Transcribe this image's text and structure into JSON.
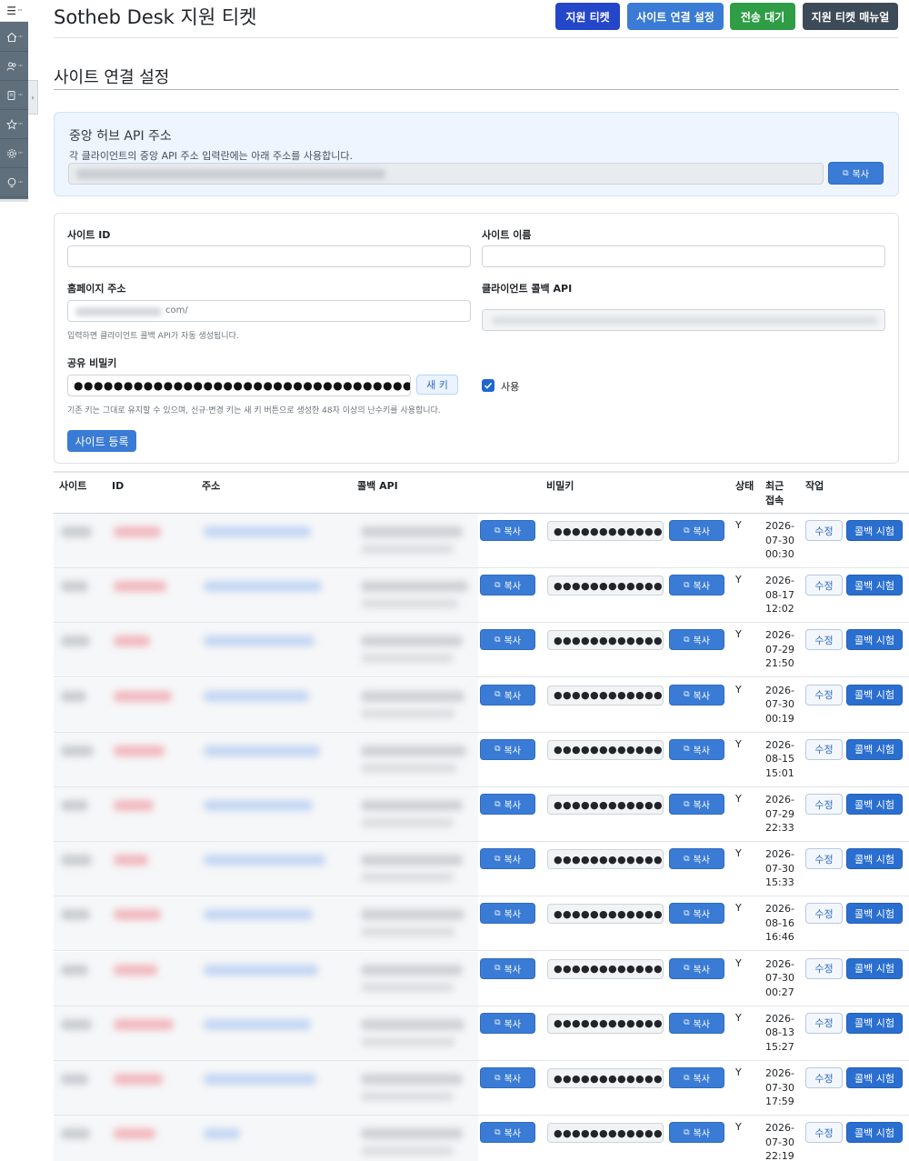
{
  "sidebar": {
    "menu_glyph": "☰",
    "items": [
      {
        "icon": "home-icon"
      },
      {
        "icon": "users-icon"
      },
      {
        "icon": "document-icon"
      },
      {
        "icon": "star-icon"
      },
      {
        "icon": "gear-icon"
      },
      {
        "icon": "help-icon"
      }
    ],
    "toggle_glyph": "›"
  },
  "header": {
    "title": "Sotheb Desk 지원 티켓",
    "buttons": [
      {
        "label": "지원 티켓",
        "color": "#2446c8"
      },
      {
        "label": "사이트 연결 설정",
        "color": "#3a7bd5"
      },
      {
        "label": "전송 대기",
        "color": "#2e9d46"
      },
      {
        "label": "지원 티켓 매뉴얼",
        "color": "#3d4a58"
      }
    ]
  },
  "section": {
    "title": "사이트 연결 설정"
  },
  "hub": {
    "title": "중앙 허브 API 주소",
    "description": "각 클라이언트의 중앙 API 주소 입력란에는 아래 주소를 사용합니다.",
    "copy_label": "복사"
  },
  "form": {
    "site_id_label": "사이트 ID",
    "site_name_label": "사이트 이름",
    "homepage_label": "홈페이지 주소",
    "homepage_value": "com/",
    "homepage_hint": "입력하면 클라이언트 콜백 API가 자동 생성됩니다.",
    "callback_label": "클라이언트 콜백 API",
    "secret_label": "공유 비밀키",
    "secret_value": "●●●●●●●●●●●●●●●●●●●●●●●●●●●●●●●●●●●●●●●●●●●●●●●●",
    "new_key_label": "새 키",
    "enabled_label": "사용",
    "secret_hint": "기존 키는 그대로 유지할 수 있으며, 신규·변경 키는 새 키 버튼으로 생성한 48자 이상의 난수키를 사용합니다.",
    "submit_label": "사이트 등록"
  },
  "table": {
    "columns": {
      "site": "사이트",
      "id": "ID",
      "address": "주소",
      "callback": "콜백 API",
      "secret": "비밀키",
      "status": "상태",
      "last_line1": "최근",
      "last_line2": "접속",
      "action": "작업"
    },
    "copy_label": "복사",
    "edit_label": "수정",
    "test_label": "콜백 시험",
    "masked_secret": "●●●●●●●●●●●●",
    "rows": [
      {
        "status": "Y",
        "date": "2026-",
        "date2": "07-30",
        "time": "00:30"
      },
      {
        "status": "Y",
        "date": "2026-",
        "date2": "08-17",
        "time": "12:02"
      },
      {
        "status": "Y",
        "date": "2026-",
        "date2": "07-29",
        "time": "21:50"
      },
      {
        "status": "Y",
        "date": "2026-",
        "date2": "07-30",
        "time": "00:19"
      },
      {
        "status": "Y",
        "date": "2026-",
        "date2": "08-15",
        "time": "15:01"
      },
      {
        "status": "Y",
        "date": "2026-",
        "date2": "07-29",
        "time": "22:33"
      },
      {
        "status": "Y",
        "date": "2026-",
        "date2": "07-30",
        "time": "15:33"
      },
      {
        "status": "Y",
        "date": "2026-",
        "date2": "08-16",
        "time": "16:46"
      },
      {
        "status": "Y",
        "date": "2026-",
        "date2": "07-30",
        "time": "00:27"
      },
      {
        "status": "Y",
        "date": "2026-",
        "date2": "08-13",
        "time": "15:27"
      },
      {
        "status": "Y",
        "date": "2026-",
        "date2": "07-30",
        "time": "17:59"
      },
      {
        "status": "Y",
        "date": "2026-",
        "date2": "07-30",
        "time": "22:19"
      }
    ]
  }
}
